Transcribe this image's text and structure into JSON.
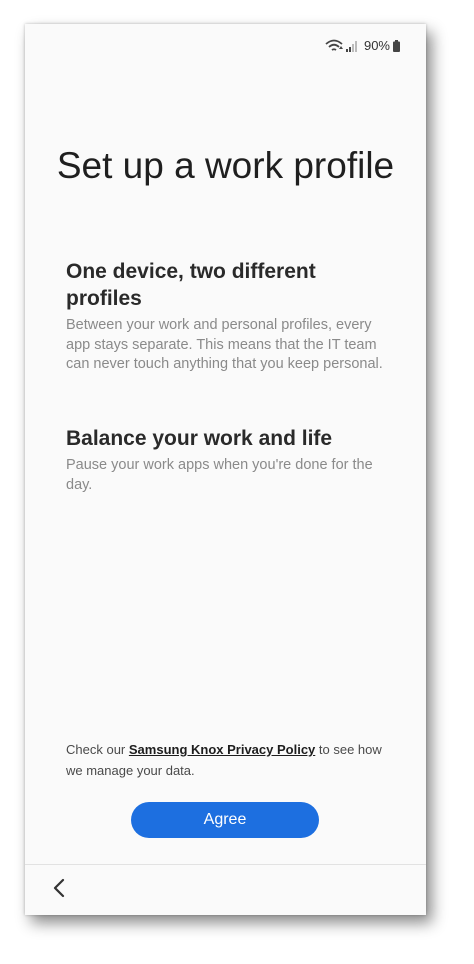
{
  "status": {
    "battery_percent": "90%",
    "icons": [
      "wifi-icon",
      "signal-icon",
      "battery-icon"
    ]
  },
  "main": {
    "title": "Set up a work profile",
    "sections": [
      {
        "heading": "One device, two different profiles",
        "body": "Between your work and personal profiles, every app stays separate. This means that the IT team can never touch anything that you keep personal."
      },
      {
        "heading": "Balance your work and life",
        "body": "Pause your work apps when you're done for the day."
      }
    ]
  },
  "privacy": {
    "prefix": "Check our ",
    "link_text": "Samsung Knox Privacy Policy",
    "suffix": " to see how we manage your data."
  },
  "actions": {
    "agree_label": "Agree"
  },
  "nav": {
    "back_icon": "chevron-left-icon"
  },
  "colors": {
    "accent": "#1d6fe0",
    "background": "#fafafa",
    "body_text": "#8a8a8a"
  }
}
